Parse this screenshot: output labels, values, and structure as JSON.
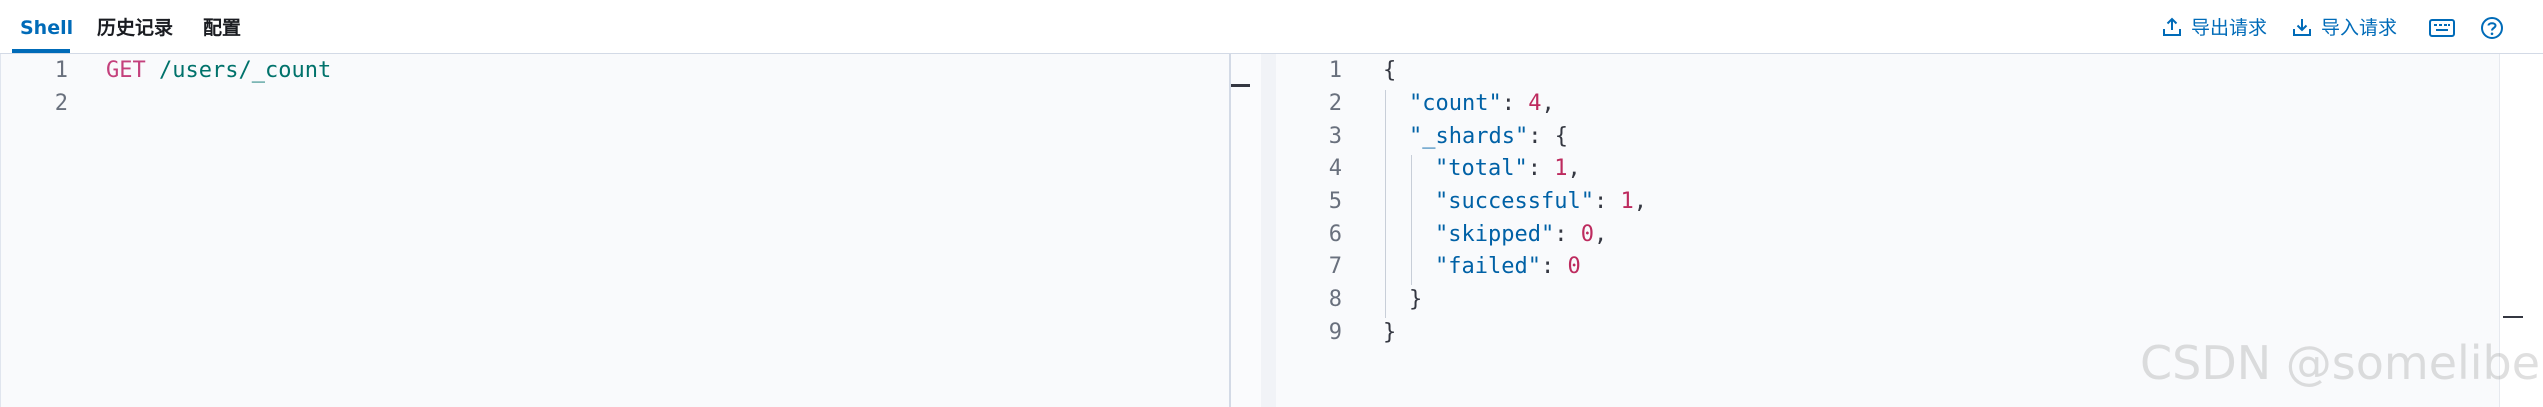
{
  "tabs": [
    {
      "label": "Shell",
      "active": true
    },
    {
      "label": "历史记录",
      "active": false
    },
    {
      "label": "配置",
      "active": false
    }
  ],
  "toolbar": {
    "export_label": "导出请求",
    "import_label": "导入请求",
    "keyboard_icon": "keyboard-icon",
    "help_icon": "help-icon"
  },
  "request": {
    "line_numbers": [
      "1",
      "2"
    ],
    "method": "GET",
    "path": "/users/_count"
  },
  "response": {
    "line_numbers": [
      "1",
      "2",
      "3",
      "4",
      "5",
      "6",
      "7",
      "8",
      "9"
    ],
    "count_key": "\"count\"",
    "count_value": "4",
    "shards_key": "\"_shards\"",
    "total_key": "\"total\"",
    "total_value": "1",
    "successful_key": "\"successful\"",
    "successful_value": "1",
    "skipped_key": "\"skipped\"",
    "skipped_value": "0",
    "failed_key": "\"failed\"",
    "failed_value": "0"
  },
  "watermark": "CSDN @someliber",
  "colors": {
    "accent": "#006bb8",
    "method": "#c4407c",
    "path": "#00726b",
    "json_key": "#0061a6",
    "json_number": "#bd2a5e"
  }
}
